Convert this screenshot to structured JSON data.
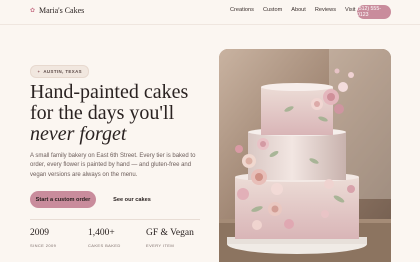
{
  "brand": {
    "name": "Maria's Cakes",
    "mark": "✿"
  },
  "nav": {
    "links": [
      "Creations",
      "Custom",
      "About",
      "Reviews",
      "Visit"
    ],
    "cta": "(512) 555-0123"
  },
  "hero": {
    "badge": "AUSTIN, TEXAS",
    "headline_line1": "Hand-painted cakes",
    "headline_line2": "for the days you'll",
    "headline_line3": "never forget",
    "lede": "A small family bakery on East 6th Street. Every tier is baked to order, every flower is painted by hand — and gluten-free and vegan versions are always on the menu.",
    "primary_button": "Start a custom order",
    "secondary_button": "See our cakes"
  },
  "stats": [
    {
      "value": "2009",
      "label": "SINCE 2009"
    },
    {
      "value": "1,400+",
      "label": "CAKES BAKED"
    },
    {
      "value": "GF & Vegan",
      "label": "EVERY ITEM"
    }
  ],
  "colors": {
    "accent": "#c98c9c",
    "background": "#fbf6f1",
    "text": "#2a2221"
  },
  "icons": {
    "brand": "flower-icon",
    "badge": "star-icon"
  }
}
